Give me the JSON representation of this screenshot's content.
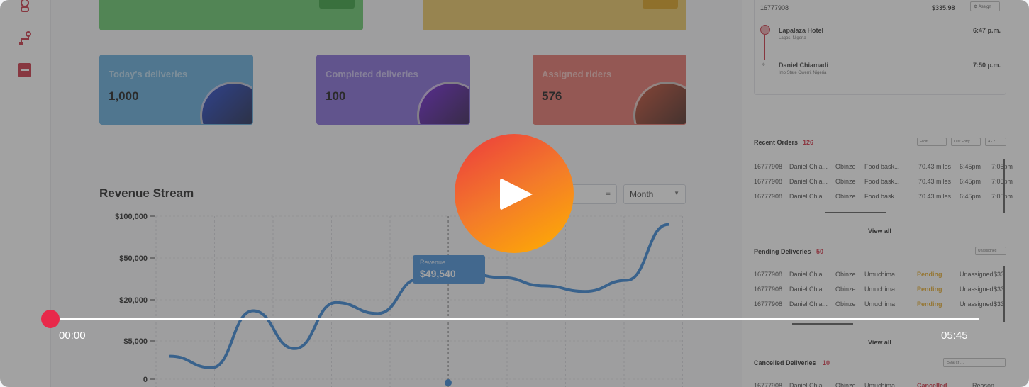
{
  "sidebar": {
    "icons": [
      "rider-icon",
      "route-icon",
      "report-icon"
    ]
  },
  "stats": [
    {
      "label": "Today's deliveries",
      "value": "1,000",
      "color": "#5aa7d8",
      "orb": "#1a3fd0"
    },
    {
      "label": "Completed deliveries",
      "value": "100",
      "color": "#7d62d4",
      "orb": "#6a16d8"
    },
    {
      "label": "Assigned riders",
      "value": "576",
      "color": "#e36a62",
      "orb": "#c5452a"
    }
  ],
  "revenue": {
    "title": "Revenue Stream",
    "filter_label": "r",
    "period": "Month",
    "tooltip": {
      "label": "Revenue",
      "value": "$49,540"
    }
  },
  "chart_data": {
    "type": "line",
    "title": "Revenue Stream",
    "y_ticks": [
      "$100,000",
      "$50,000",
      "$20,000",
      "$5,000",
      "0"
    ],
    "series": [
      {
        "name": "Revenue",
        "points": [
          [
            0,
            3000
          ],
          [
            1,
            1500
          ],
          [
            2,
            16000
          ],
          [
            3,
            4000
          ],
          [
            4,
            19000
          ],
          [
            5,
            15000
          ],
          [
            6,
            35000
          ],
          [
            7,
            40000
          ],
          [
            8,
            36000
          ],
          [
            9,
            30000
          ],
          [
            10,
            26000
          ],
          [
            11,
            34000
          ],
          [
            12,
            90000
          ]
        ]
      }
    ],
    "grid": true,
    "color": "#2d7fd2"
  },
  "order_card": {
    "order_id": "16777908",
    "amount": "$335.98",
    "assign_label": "Assign",
    "pickup": {
      "name": "Lapalaza Hotel",
      "place": "Lagos, Nigeria",
      "time": "6:47 p.m."
    },
    "dropoff": {
      "name": "Daniel Chiamadi",
      "place": "Imo State Owerri, Nigeria",
      "time": "7:50 p.m."
    }
  },
  "recent_orders": {
    "title": "Recent Orders",
    "count": "126",
    "filters": [
      "Flldltr",
      "Last Entry",
      "A - Z"
    ],
    "rows": [
      [
        "16777908",
        "Daniel Chia...",
        "Obinze",
        "Food bask...",
        "70.43 miles",
        "6:45pm",
        "7:05pm"
      ],
      [
        "16777908",
        "Daniel Chia...",
        "Obinze",
        "Food bask...",
        "70.43 miles",
        "6:45pm",
        "7:05pm"
      ],
      [
        "16777908",
        "Daniel Chia...",
        "Obinze",
        "Food bask...",
        "70.43 miles",
        "6:45pm",
        "7:05pm"
      ]
    ],
    "view_all": "View all"
  },
  "pending": {
    "title": "Pending Deliveries",
    "count": "50",
    "filter": "Unassigned",
    "rows": [
      [
        "16777908",
        "Daniel Chia...",
        "Obinze",
        "Umuchima",
        "Pending",
        "Unassigned",
        "$33"
      ],
      [
        "16777908",
        "Daniel Chia...",
        "Obinze",
        "Umuchima",
        "Pending",
        "Unassigned",
        "$33"
      ],
      [
        "16777908",
        "Daniel Chia...",
        "Obinze",
        "Umuchima",
        "Pending",
        "Unassigned",
        "$33"
      ]
    ],
    "view_all": "View all"
  },
  "cancelled": {
    "title": "Cancelled Deliveries",
    "count": "10",
    "search_placeholder": "Search...",
    "row": [
      "16777908",
      "Daniel Chia...",
      "Obinze",
      "Umuchima",
      "Cancelled",
      "Reason"
    ]
  },
  "player": {
    "current_time": "00:00",
    "duration": "05:45",
    "progress": 0
  }
}
